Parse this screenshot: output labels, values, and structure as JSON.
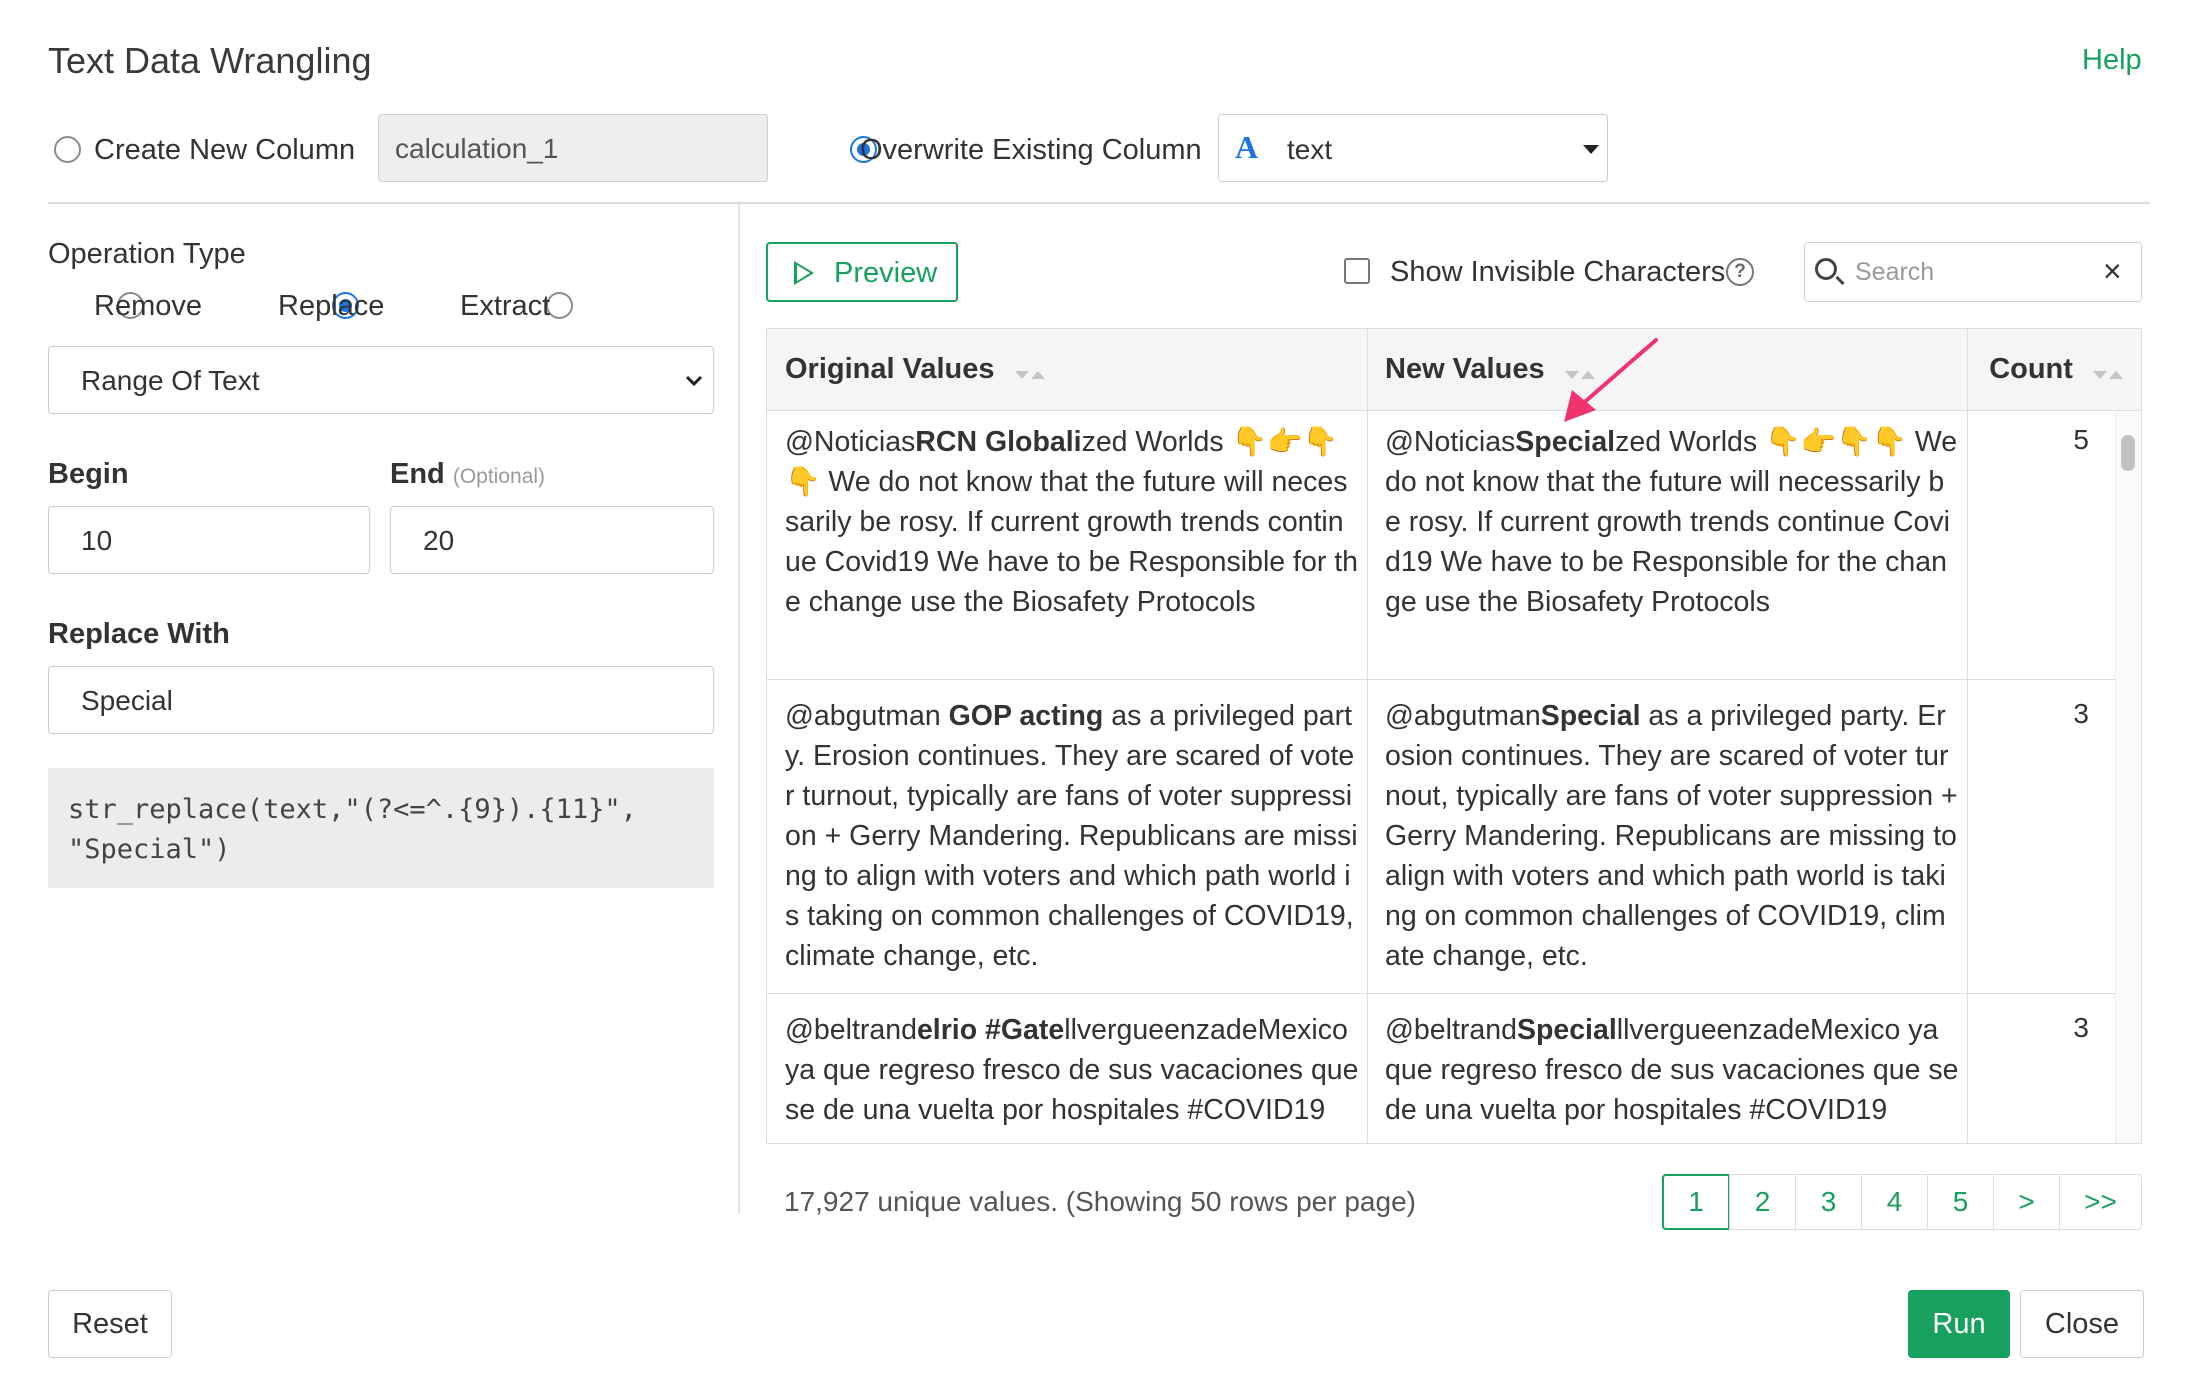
{
  "dialog": {
    "title": "Text Data Wrangling",
    "help_label": "Help"
  },
  "output": {
    "create_new_label": "Create New Column",
    "new_column_name": "calculation_1",
    "overwrite_label": "Overwrite Existing Column",
    "selected_column": "text",
    "selected_column_type_icon": "A",
    "mode": "overwrite"
  },
  "operation": {
    "heading": "Operation Type",
    "types": [
      "Remove",
      "Replace",
      "Extract"
    ],
    "selected_type": "Replace",
    "target": "Range Of Text",
    "begin_label": "Begin",
    "begin_value": "10",
    "end_label": "End",
    "end_optional": "(Optional)",
    "end_value": "20",
    "replace_with_label": "Replace With",
    "replace_with_value": "Special",
    "expression": "str_replace(text,\"(?<=^.{9}).{11}\",\n\"Special\")"
  },
  "preview": {
    "button_label": "Preview",
    "show_invisible_label": "Show Invisible Characters",
    "show_invisible_checked": false,
    "help_glyph": "?",
    "search_placeholder": "Search",
    "columns": [
      "Original Values",
      "New Values",
      "Count"
    ],
    "rows": [
      {
        "orig_a": "@Noticias",
        "orig_b": "RCN Globali",
        "orig_c": "zed Worlds 👇👉👇👇 We do not know that the future will necessarily be rosy. If current growth trends continue Covid19 We have to be Responsible for the change use the Biosafety Protocols",
        "new_a": "@Noticias",
        "new_b": "Special",
        "new_c": "zed Worlds 👇👉👇👇 We do not know that the future will necessarily be rosy. If current growth trends continue Covid19 We have to be Responsible for the change use the Biosafety Protocols",
        "count": "5"
      },
      {
        "orig_a": "@abgutman ",
        "orig_b": "GOP acting",
        "orig_c": " as a privileged party. Erosion continues. They are scared of voter turnout, typically are fans of voter suppression + Gerry Mandering. Republicans are missing to align with voters and which path world is taking on common challenges of COVID19, climate change, etc.",
        "new_a": "@abgutman",
        "new_b": "Special",
        "new_c": " as a privileged party. Erosion continues. They are scared of voter turnout, typically are fans of voter suppression + Gerry Mandering. Republicans are missing to align with voters and which path world is taking on common challenges of COVID19, climate change, etc.",
        "count": "3"
      },
      {
        "orig_a": "@beltrand",
        "orig_b": "elrio #Gate",
        "orig_c": "llvergueenzadeMexico ya que regreso fresco de sus vacaciones que se de una vuelta por hospitales #COVID19",
        "new_a": "@beltrand",
        "new_b": "Special",
        "new_c": "llvergueenzadeMexico ya que regreso fresco de sus vacaciones que se de una vuelta por hospitales #COVID19",
        "count": "3"
      }
    ],
    "summary": "17,927 unique values. (Showing 50 rows per page)",
    "pages": [
      "1",
      "2",
      "3",
      "4",
      "5",
      ">",
      ">>"
    ],
    "current_page": "1"
  },
  "footer": {
    "reset_label": "Reset",
    "run_label": "Run",
    "close_label": "Close"
  },
  "colors": {
    "accent_green": "#18a05e",
    "radio_blue": "#1a73e8",
    "arrow_pink": "#f0336e"
  }
}
